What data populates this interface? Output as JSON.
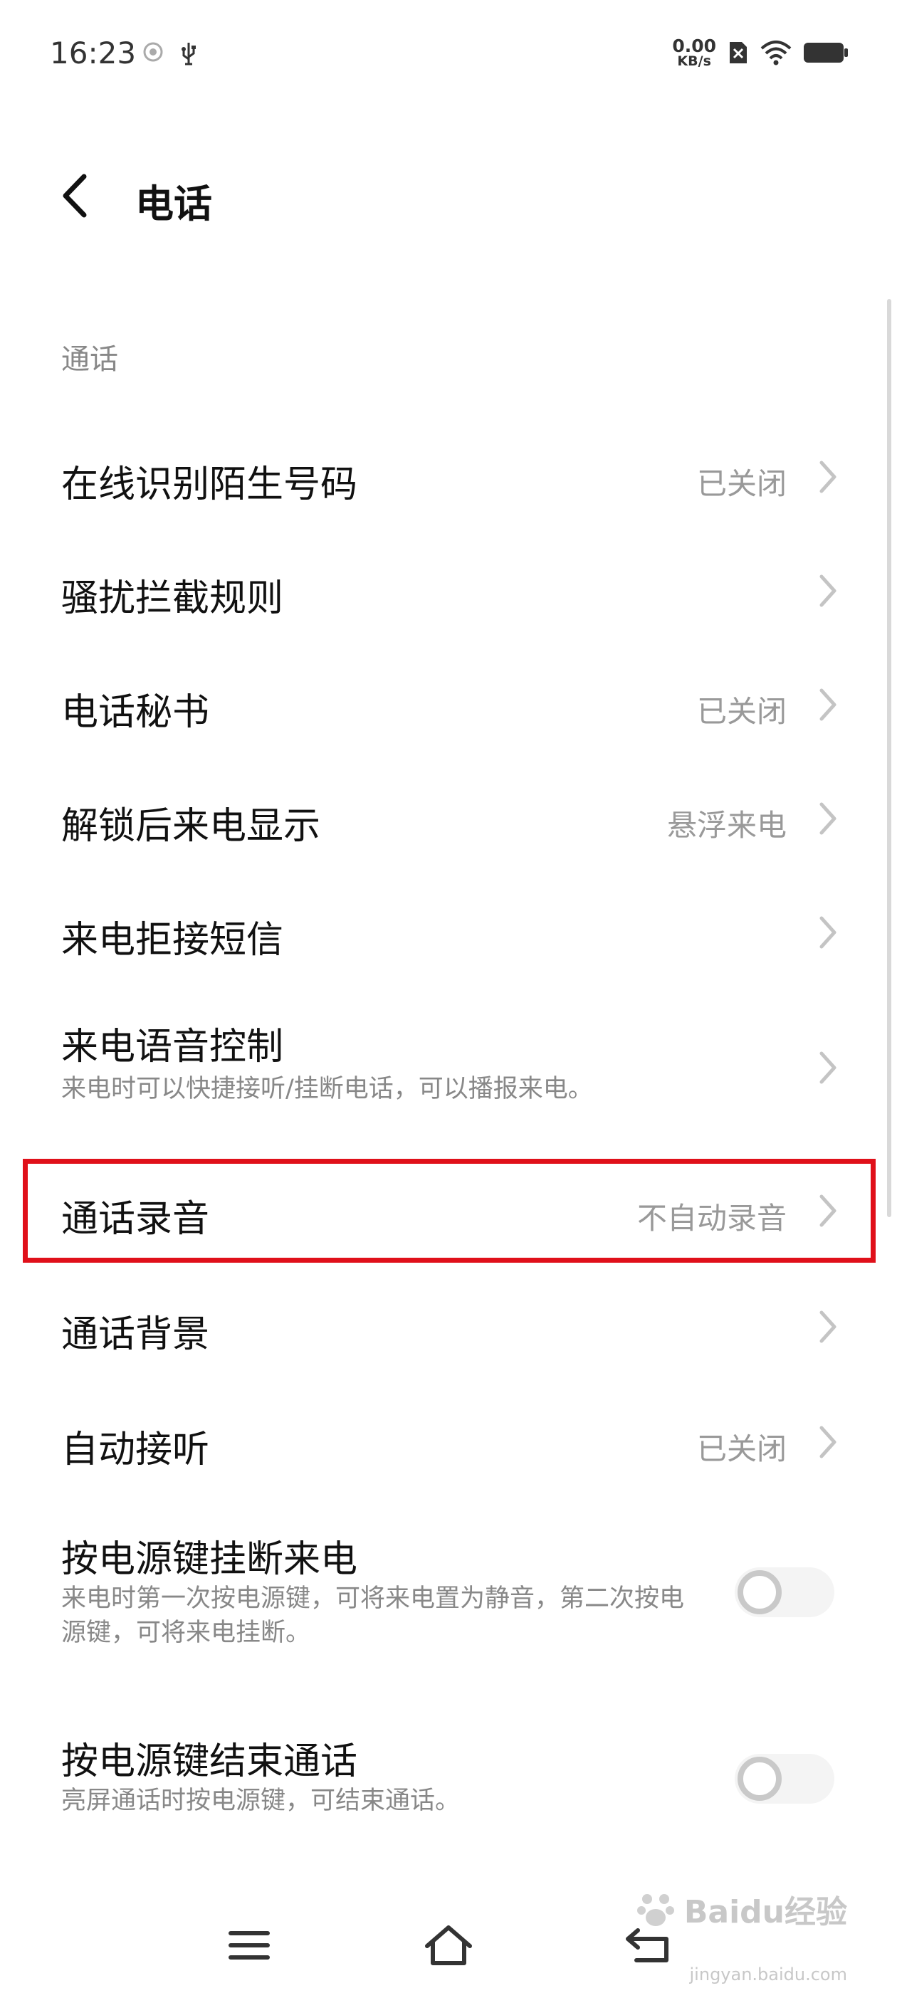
{
  "status_bar": {
    "time": "16:23",
    "net_speed_value": "0.00",
    "net_speed_unit": "KB/s"
  },
  "header": {
    "title": "电话"
  },
  "section": {
    "label": "通话"
  },
  "rows": [
    {
      "title": "在线识别陌生号码",
      "value": "已关闭"
    },
    {
      "title": "骚扰拦截规则",
      "value": ""
    },
    {
      "title": "电话秘书",
      "value": "已关闭"
    },
    {
      "title": "解锁后来电显示",
      "value": "悬浮来电"
    },
    {
      "title": "来电拒接短信",
      "value": ""
    },
    {
      "title": "来电语音控制",
      "subtitle": "来电时可以快捷接听/挂断电话，可以播报来电。"
    },
    {
      "title": "通话录音",
      "value": "不自动录音"
    },
    {
      "title": "通话背景",
      "value": ""
    },
    {
      "title": "自动接听",
      "value": "已关闭"
    },
    {
      "title": "按电源键挂断来电",
      "subtitle": "来电时第一次按电源键，可将来电置为静音，第二次按电源键，可将来电挂断。",
      "enabled": false
    },
    {
      "title": "按电源键结束通话",
      "subtitle": "亮屏通话时按电源键，可结束通话。",
      "enabled": false
    }
  ],
  "watermark": {
    "text": "Baidu经验",
    "url": "jingyan.baidu.com"
  },
  "colors": {
    "highlight": "#e0101a",
    "text_primary": "#111111",
    "text_secondary": "#888888"
  }
}
